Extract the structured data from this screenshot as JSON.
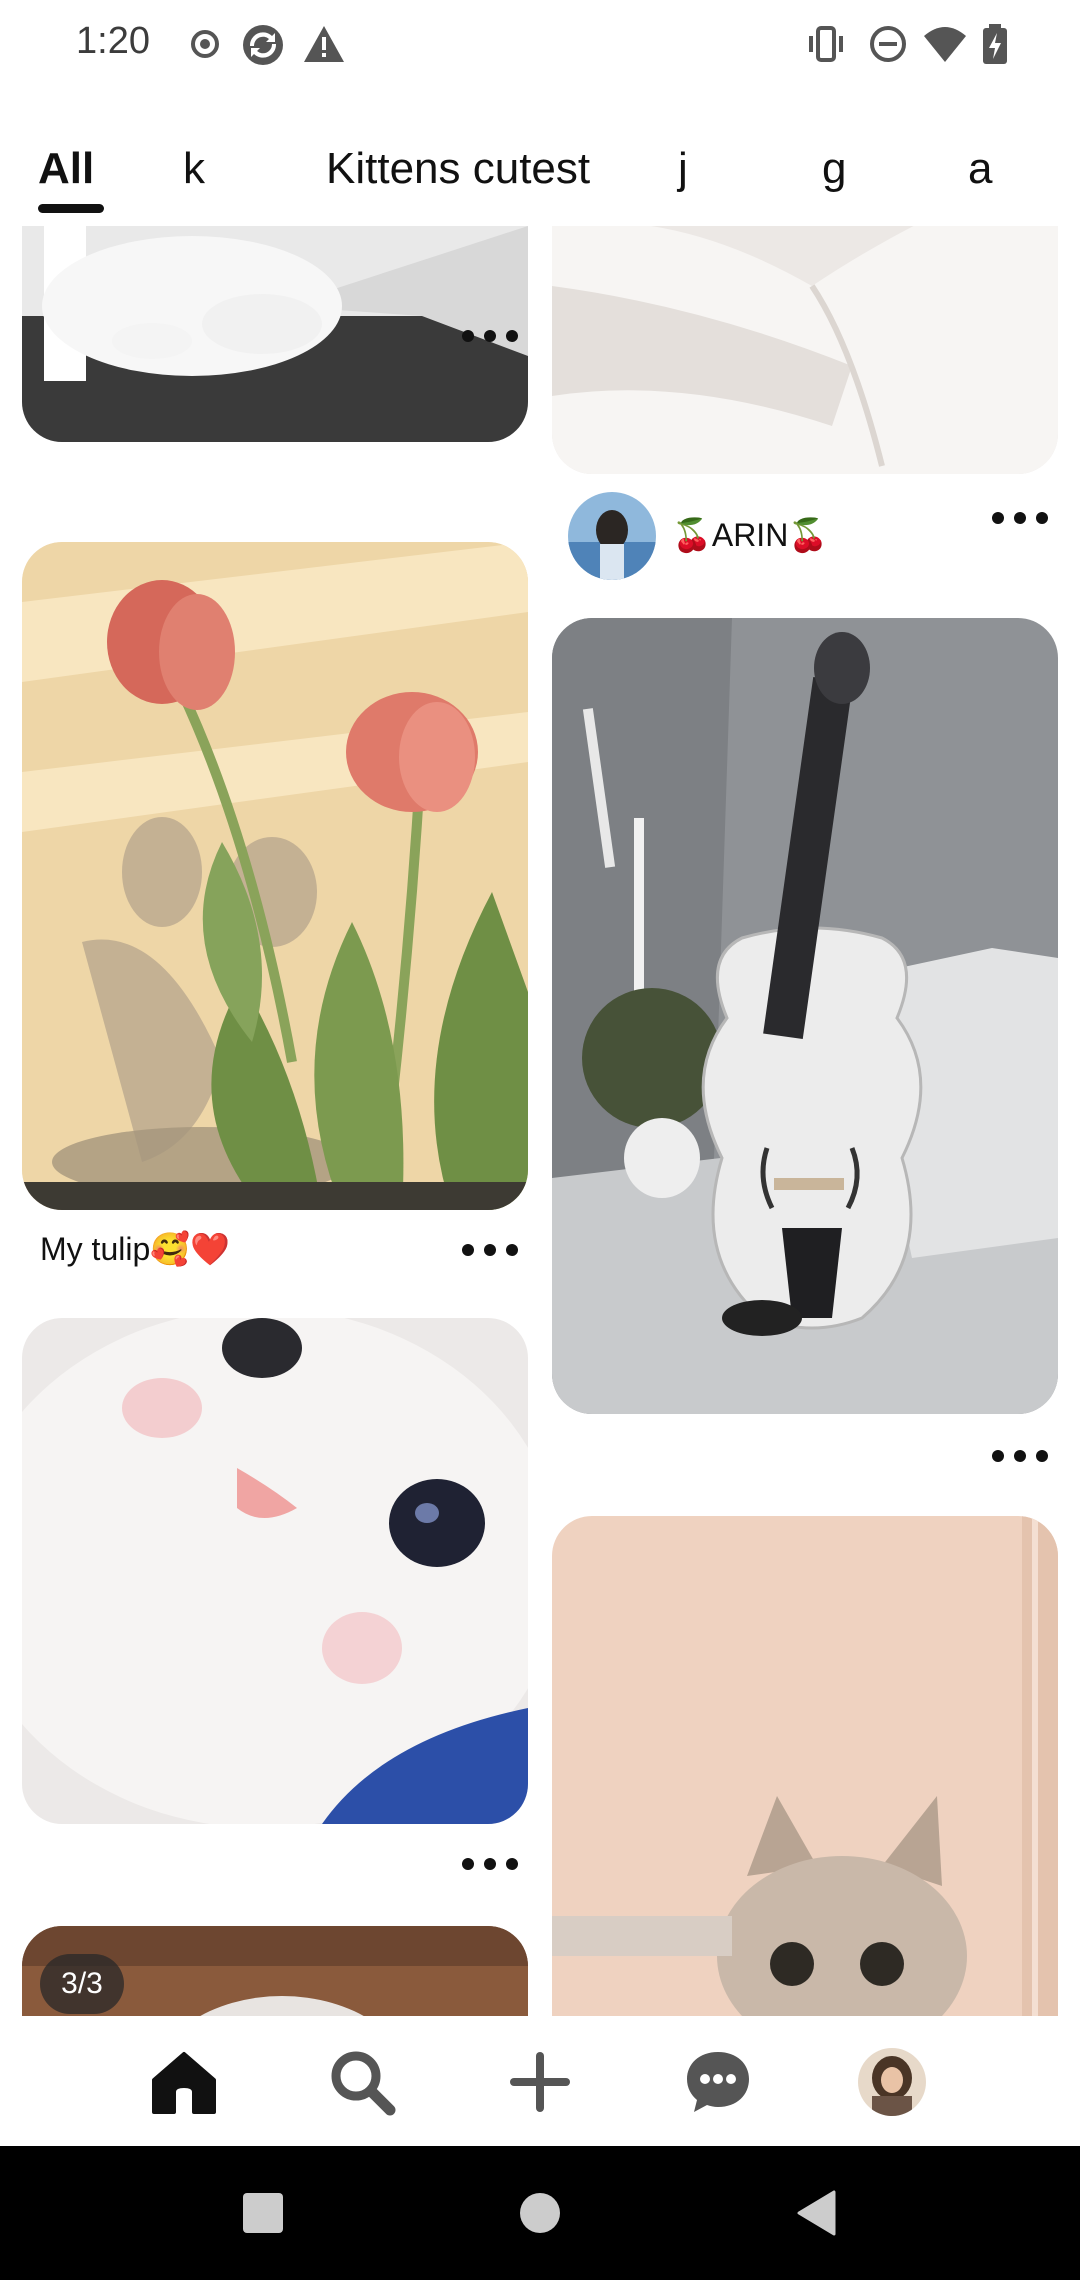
{
  "status_bar": {
    "time": "1:20",
    "left_icons": [
      "record-icon",
      "sync-icon",
      "warning-icon"
    ],
    "right_icons": [
      "vibrate-icon",
      "do-not-disturb-icon",
      "wifi-icon",
      "battery-charging-icon"
    ]
  },
  "tabs": [
    {
      "label": "All",
      "selected": true
    },
    {
      "label": "k",
      "selected": false
    },
    {
      "label": "Kittens cutest",
      "selected": false
    },
    {
      "label": "j",
      "selected": false
    },
    {
      "label": "g",
      "selected": false
    },
    {
      "label": "a",
      "selected": false
    }
  ],
  "pins": {
    "left": [
      {
        "title": ""
      },
      {
        "title": "My tulip🥰❤️"
      },
      {
        "title": ""
      },
      {
        "title": "",
        "page_badge": "3/3"
      }
    ],
    "right": [
      {
        "title": "",
        "author": "🍒ARIN🍒"
      },
      {
        "title": ""
      },
      {
        "title": ""
      }
    ]
  },
  "bottom_nav": [
    "home-icon",
    "search-icon",
    "create-icon",
    "messages-icon",
    "profile-avatar"
  ],
  "system_nav": [
    "recents-button",
    "home-button",
    "back-button"
  ],
  "colors": {
    "accent": "#111111",
    "background": "#ffffff",
    "icon_gray": "#555555"
  }
}
